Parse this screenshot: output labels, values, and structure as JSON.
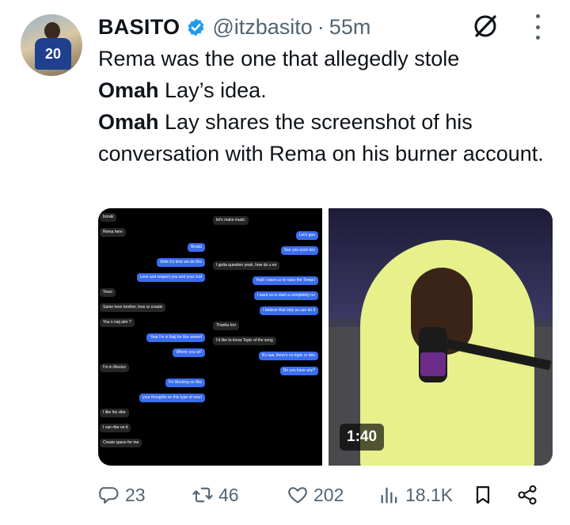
{
  "tweet": {
    "display_name": "BASITO",
    "handle": "@itzbasito",
    "separator": "·",
    "time": "55m",
    "body": {
      "line1": "Rema was the one that allegedly stole",
      "line2_bold": "Omah",
      "line2_rest": " Lay’s idea.",
      "line3_bold": "Omah",
      "line3_rest": " Lay shares the screenshot of his conversation with Rema on his burner account."
    },
    "avatar_jersey_text": "20",
    "media": {
      "video_duration": "1:40",
      "chat_messages": [
        {
          "text": "broski",
          "side": "in"
        },
        {
          "text": "Rema here",
          "side": "in"
        },
        {
          "text": "Broski",
          "side": "out"
        },
        {
          "text": "think it's time we do this",
          "side": "out"
        },
        {
          "text": "Love and respect you and your craft",
          "side": "out"
        },
        {
          "text": "Yessi",
          "side": "in"
        },
        {
          "text": "Same here brother, love ur creative perspective",
          "side": "in"
        },
        {
          "text": "You n naij atm ?",
          "side": "in"
        },
        {
          "text": "Yeat I'm in Naij for like sometf",
          "side": "out"
        },
        {
          "text": "Where you at?",
          "side": "out"
        },
        {
          "text": "I'm in Mexico",
          "side": "in"
        },
        {
          "text": "I'm Working on this",
          "side": "out"
        },
        {
          "text": "your thoughts on this type of sound?",
          "side": "out"
        },
        {
          "text": "I like his vibe",
          "side": "in"
        },
        {
          "text": "I can ribe on it",
          "side": "in"
        },
        {
          "text": "Create space for me",
          "side": "in"
        },
        {
          "text": "let's make music",
          "side": "in"
        },
        {
          "text": "Let's goo",
          "side": "out"
        },
        {
          "text": "See you soon bro",
          "side": "out"
        },
        {
          "text": "I gotta question yeah, how do u envision a song with us ?",
          "side": "in"
        },
        {
          "text": "Yeah I want us to raise the Tempo of the sound",
          "side": "out"
        },
        {
          "text": "I want us to start a completely new type of wave",
          "side": "out"
        },
        {
          "text": "I believe that only us can do it",
          "side": "out"
        },
        {
          "text": "Thanks bro",
          "side": "in"
        },
        {
          "text": "I'd like to know Topic of the song",
          "side": "in"
        },
        {
          "text": "It's raw, there's no topic or direction yet",
          "side": "out"
        },
        {
          "text": "Do you have any?",
          "side": "out"
        }
      ]
    },
    "stats": {
      "replies": "23",
      "reposts": "46",
      "likes": "202",
      "views": "18.1K"
    },
    "colors": {
      "verified": "#1d9bf0",
      "muted_text": "#536471",
      "text": "#0f1419",
      "chat_out": "#3a6df0",
      "chat_in": "#262626"
    },
    "icons": [
      "verified-badge-icon",
      "grok-icon",
      "more-icon",
      "reply-icon",
      "repost-icon",
      "like-icon",
      "views-icon",
      "bookmark-icon",
      "share-icon"
    ]
  }
}
